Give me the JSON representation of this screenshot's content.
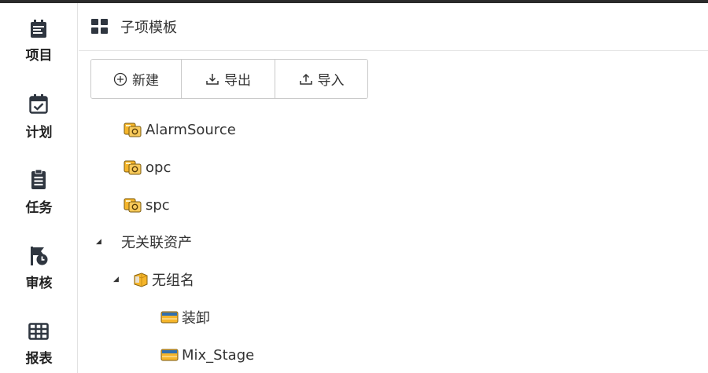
{
  "sidebar": {
    "items": [
      {
        "label": "项目",
        "icon": "project-icon"
      },
      {
        "label": "计划",
        "icon": "calendar-check-icon"
      },
      {
        "label": "任务",
        "icon": "clipboard-icon"
      },
      {
        "label": "审核",
        "icon": "flag-clock-icon"
      },
      {
        "label": "报表",
        "icon": "table-icon"
      }
    ]
  },
  "header": {
    "title": "子项模板",
    "icon": "grid-icon"
  },
  "toolbar": {
    "new_label": "新建",
    "export_label": "导出",
    "import_label": "导入"
  },
  "tree": [
    {
      "label": "AlarmSource",
      "icon": "template-node-icon",
      "level": 0
    },
    {
      "label": "opc",
      "icon": "template-node-icon",
      "level": 0
    },
    {
      "label": "spc",
      "icon": "template-node-icon",
      "level": 0
    },
    {
      "label": "无关联资产",
      "icon": "",
      "expanded": true,
      "level": 0
    },
    {
      "label": "无组名",
      "icon": "group-folder-icon",
      "expanded": true,
      "level": 1
    },
    {
      "label": "装卸",
      "icon": "asset-item-icon",
      "level": 2
    },
    {
      "label": "Mix_Stage",
      "icon": "asset-item-icon",
      "level": 2
    }
  ],
  "colors": {
    "accent_yellow": "#f5b52a",
    "asset_blue": "#2f6fb0"
  }
}
